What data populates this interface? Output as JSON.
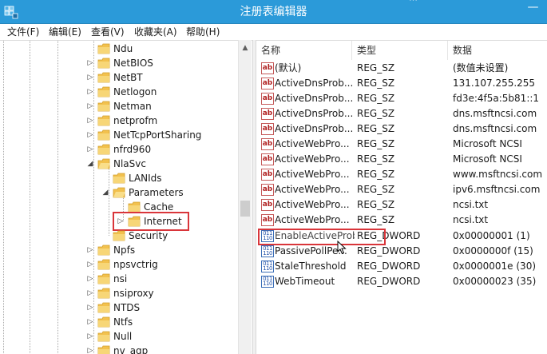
{
  "window": {
    "title": "注册表编辑器",
    "title_ghost": "…",
    "minimize_glyph": "—"
  },
  "menu": [
    {
      "label": "文件(F)"
    },
    {
      "label": "编辑(E)"
    },
    {
      "label": "查看(V)"
    },
    {
      "label": "收藏夹(A)"
    },
    {
      "label": "帮助(H)"
    }
  ],
  "tree": {
    "items": [
      {
        "label": "Ndu",
        "expander": ""
      },
      {
        "label": "NetBIOS",
        "expander": "▷"
      },
      {
        "label": "NetBT",
        "expander": "▷"
      },
      {
        "label": "Netlogon",
        "expander": "▷"
      },
      {
        "label": "Netman",
        "expander": "▷"
      },
      {
        "label": "netprofm",
        "expander": "▷"
      },
      {
        "label": "NetTcpPortSharing",
        "expander": "▷"
      },
      {
        "label": "nfrd960",
        "expander": "▷"
      },
      {
        "label": "NlaSvc",
        "expander": "◢"
      },
      {
        "label": "LANIds",
        "expander": ""
      },
      {
        "label": "Parameters",
        "expander": "◢"
      },
      {
        "label": "Cache",
        "expander": ""
      },
      {
        "label": "Internet",
        "expander": "▷",
        "selected": true
      },
      {
        "label": "Security",
        "expander": ""
      },
      {
        "label": "Npfs",
        "expander": "▷"
      },
      {
        "label": "npsvctrig",
        "expander": "▷"
      },
      {
        "label": "nsi",
        "expander": "▷"
      },
      {
        "label": "nsiproxy",
        "expander": "▷"
      },
      {
        "label": "NTDS",
        "expander": "▷"
      },
      {
        "label": "Ntfs",
        "expander": "▷"
      },
      {
        "label": "Null",
        "expander": "▷"
      },
      {
        "label": "nv_agp",
        "expander": "▷"
      }
    ]
  },
  "list": {
    "columns": {
      "name": "名称",
      "type": "类型",
      "data": "数据"
    },
    "rows": [
      {
        "icon": "string-value-icon",
        "name": "(默认)",
        "type": "REG_SZ",
        "data": "(数值未设置)"
      },
      {
        "icon": "string-value-icon",
        "name": "ActiveDnsProb...",
        "type": "REG_SZ",
        "data": "131.107.255.255"
      },
      {
        "icon": "string-value-icon",
        "name": "ActiveDnsProb...",
        "type": "REG_SZ",
        "data": "fd3e:4f5a:5b81::1"
      },
      {
        "icon": "string-value-icon",
        "name": "ActiveDnsProb...",
        "type": "REG_SZ",
        "data": "dns.msftncsi.com"
      },
      {
        "icon": "string-value-icon",
        "name": "ActiveDnsProb...",
        "type": "REG_SZ",
        "data": "dns.msftncsi.com"
      },
      {
        "icon": "string-value-icon",
        "name": "ActiveWebPro...",
        "type": "REG_SZ",
        "data": "Microsoft NCSI"
      },
      {
        "icon": "string-value-icon",
        "name": "ActiveWebPro...",
        "type": "REG_SZ",
        "data": "Microsoft NCSI"
      },
      {
        "icon": "string-value-icon",
        "name": "ActiveWebPro...",
        "type": "REG_SZ",
        "data": "www.msftncsi.com"
      },
      {
        "icon": "string-value-icon",
        "name": "ActiveWebPro...",
        "type": "REG_SZ",
        "data": "ipv6.msftncsi.com"
      },
      {
        "icon": "string-value-icon",
        "name": "ActiveWebPro...",
        "type": "REG_SZ",
        "data": "ncsi.txt"
      },
      {
        "icon": "string-value-icon",
        "name": "ActiveWebPro...",
        "type": "REG_SZ",
        "data": "ncsi.txt"
      },
      {
        "icon": "dword-value-icon",
        "name": "EnableActiveProbing",
        "type": "REG_DWORD",
        "data": "0x00000001 (1)",
        "highlighted": true
      },
      {
        "icon": "dword-value-icon",
        "name": "PassivePollPe...",
        "type": "REG_DWORD",
        "data": "0x0000000f (15)"
      },
      {
        "icon": "dword-value-icon",
        "name": "StaleThreshold",
        "type": "REG_DWORD",
        "data": "0x0000001e (30)"
      },
      {
        "icon": "dword-value-icon",
        "name": "WebTimeout",
        "type": "REG_DWORD",
        "data": "0x00000023 (35)"
      }
    ]
  },
  "colors": {
    "titlebar": "#2b9ad9",
    "highlight_border": "#d9353a",
    "folder": "#f2c14e"
  }
}
